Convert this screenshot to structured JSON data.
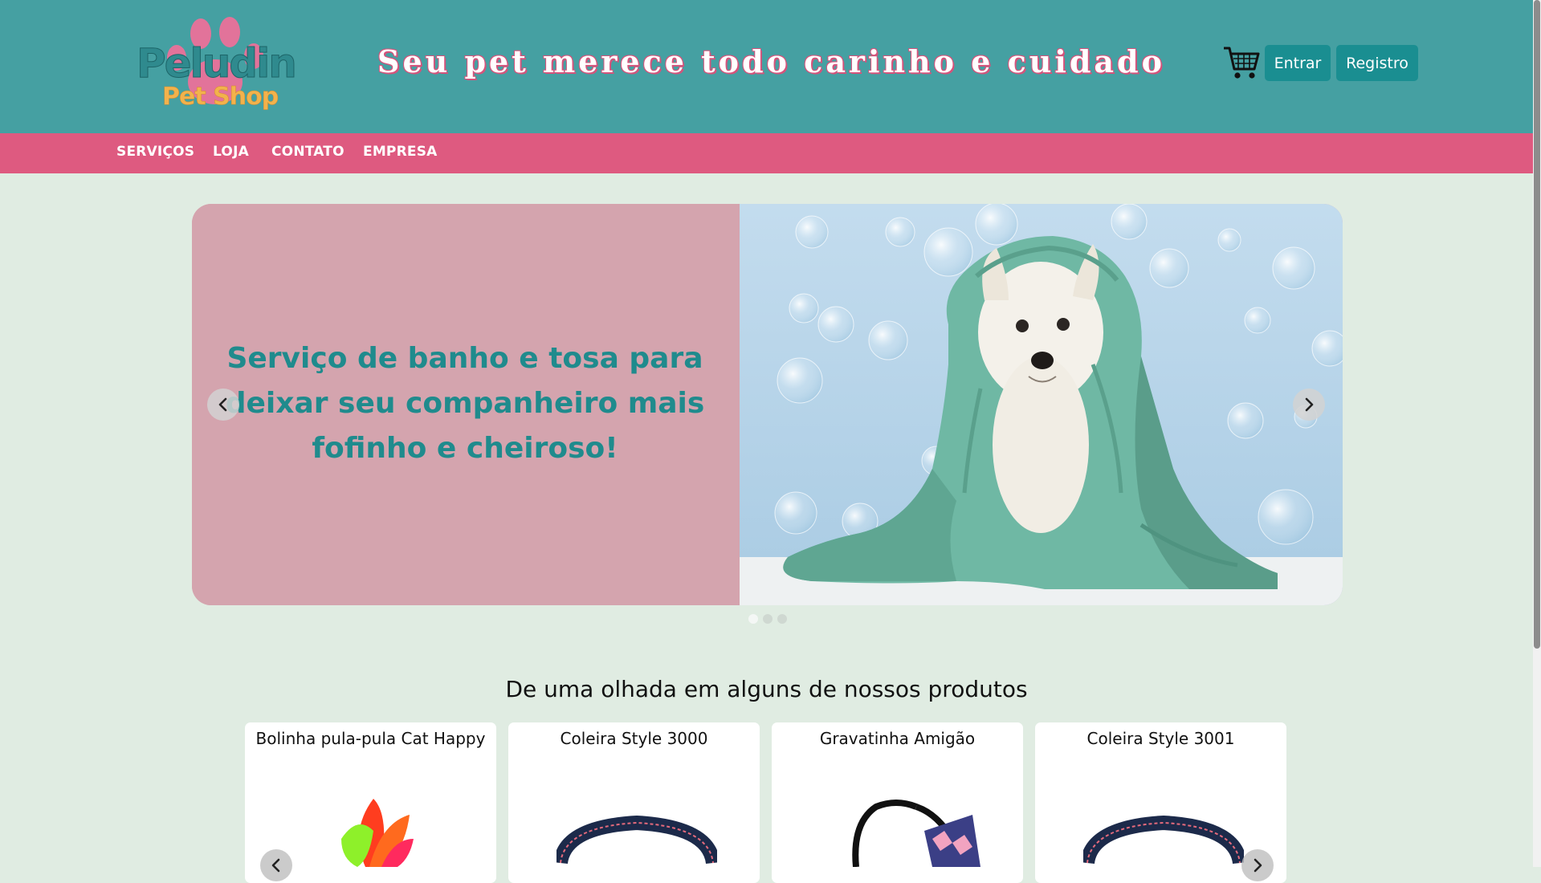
{
  "header": {
    "logo_name": "Peludin",
    "logo_sub": "Pet Shop",
    "tagline": "Seu pet merece todo carinho e cuidado",
    "cart_icon": "shopping-cart-icon",
    "login_label": "Entrar",
    "register_label": "Registro"
  },
  "nav": {
    "items": [
      {
        "label": "SERVIÇOS"
      },
      {
        "label": "LOJA"
      },
      {
        "label": "CONTATO"
      },
      {
        "label": "EMPRESA"
      }
    ]
  },
  "carousel": {
    "slides": [
      {
        "text": "Serviço de banho e tosa para deixar seu companheiro mais fofinho e cheiroso!"
      }
    ],
    "active_index": 0,
    "total_slides": 3,
    "prev_icon": "chevron-left-icon",
    "next_icon": "chevron-right-icon"
  },
  "products": {
    "title": "De uma olhada em alguns de nossos produtos",
    "items": [
      {
        "name": "Bolinha pula-pula Cat Happy"
      },
      {
        "name": "Coleira Style 3000"
      },
      {
        "name": "Gravatinha Amigão"
      },
      {
        "name": "Coleira Style 3001"
      }
    ]
  },
  "colors": {
    "header_bg": "#45a0a2",
    "nav_bg": "#de5a80",
    "page_bg": "#e0ece2",
    "button_bg": "#1a8e91",
    "slide_panel": "#d4a4ae",
    "slide_text": "#1f8b8d"
  }
}
